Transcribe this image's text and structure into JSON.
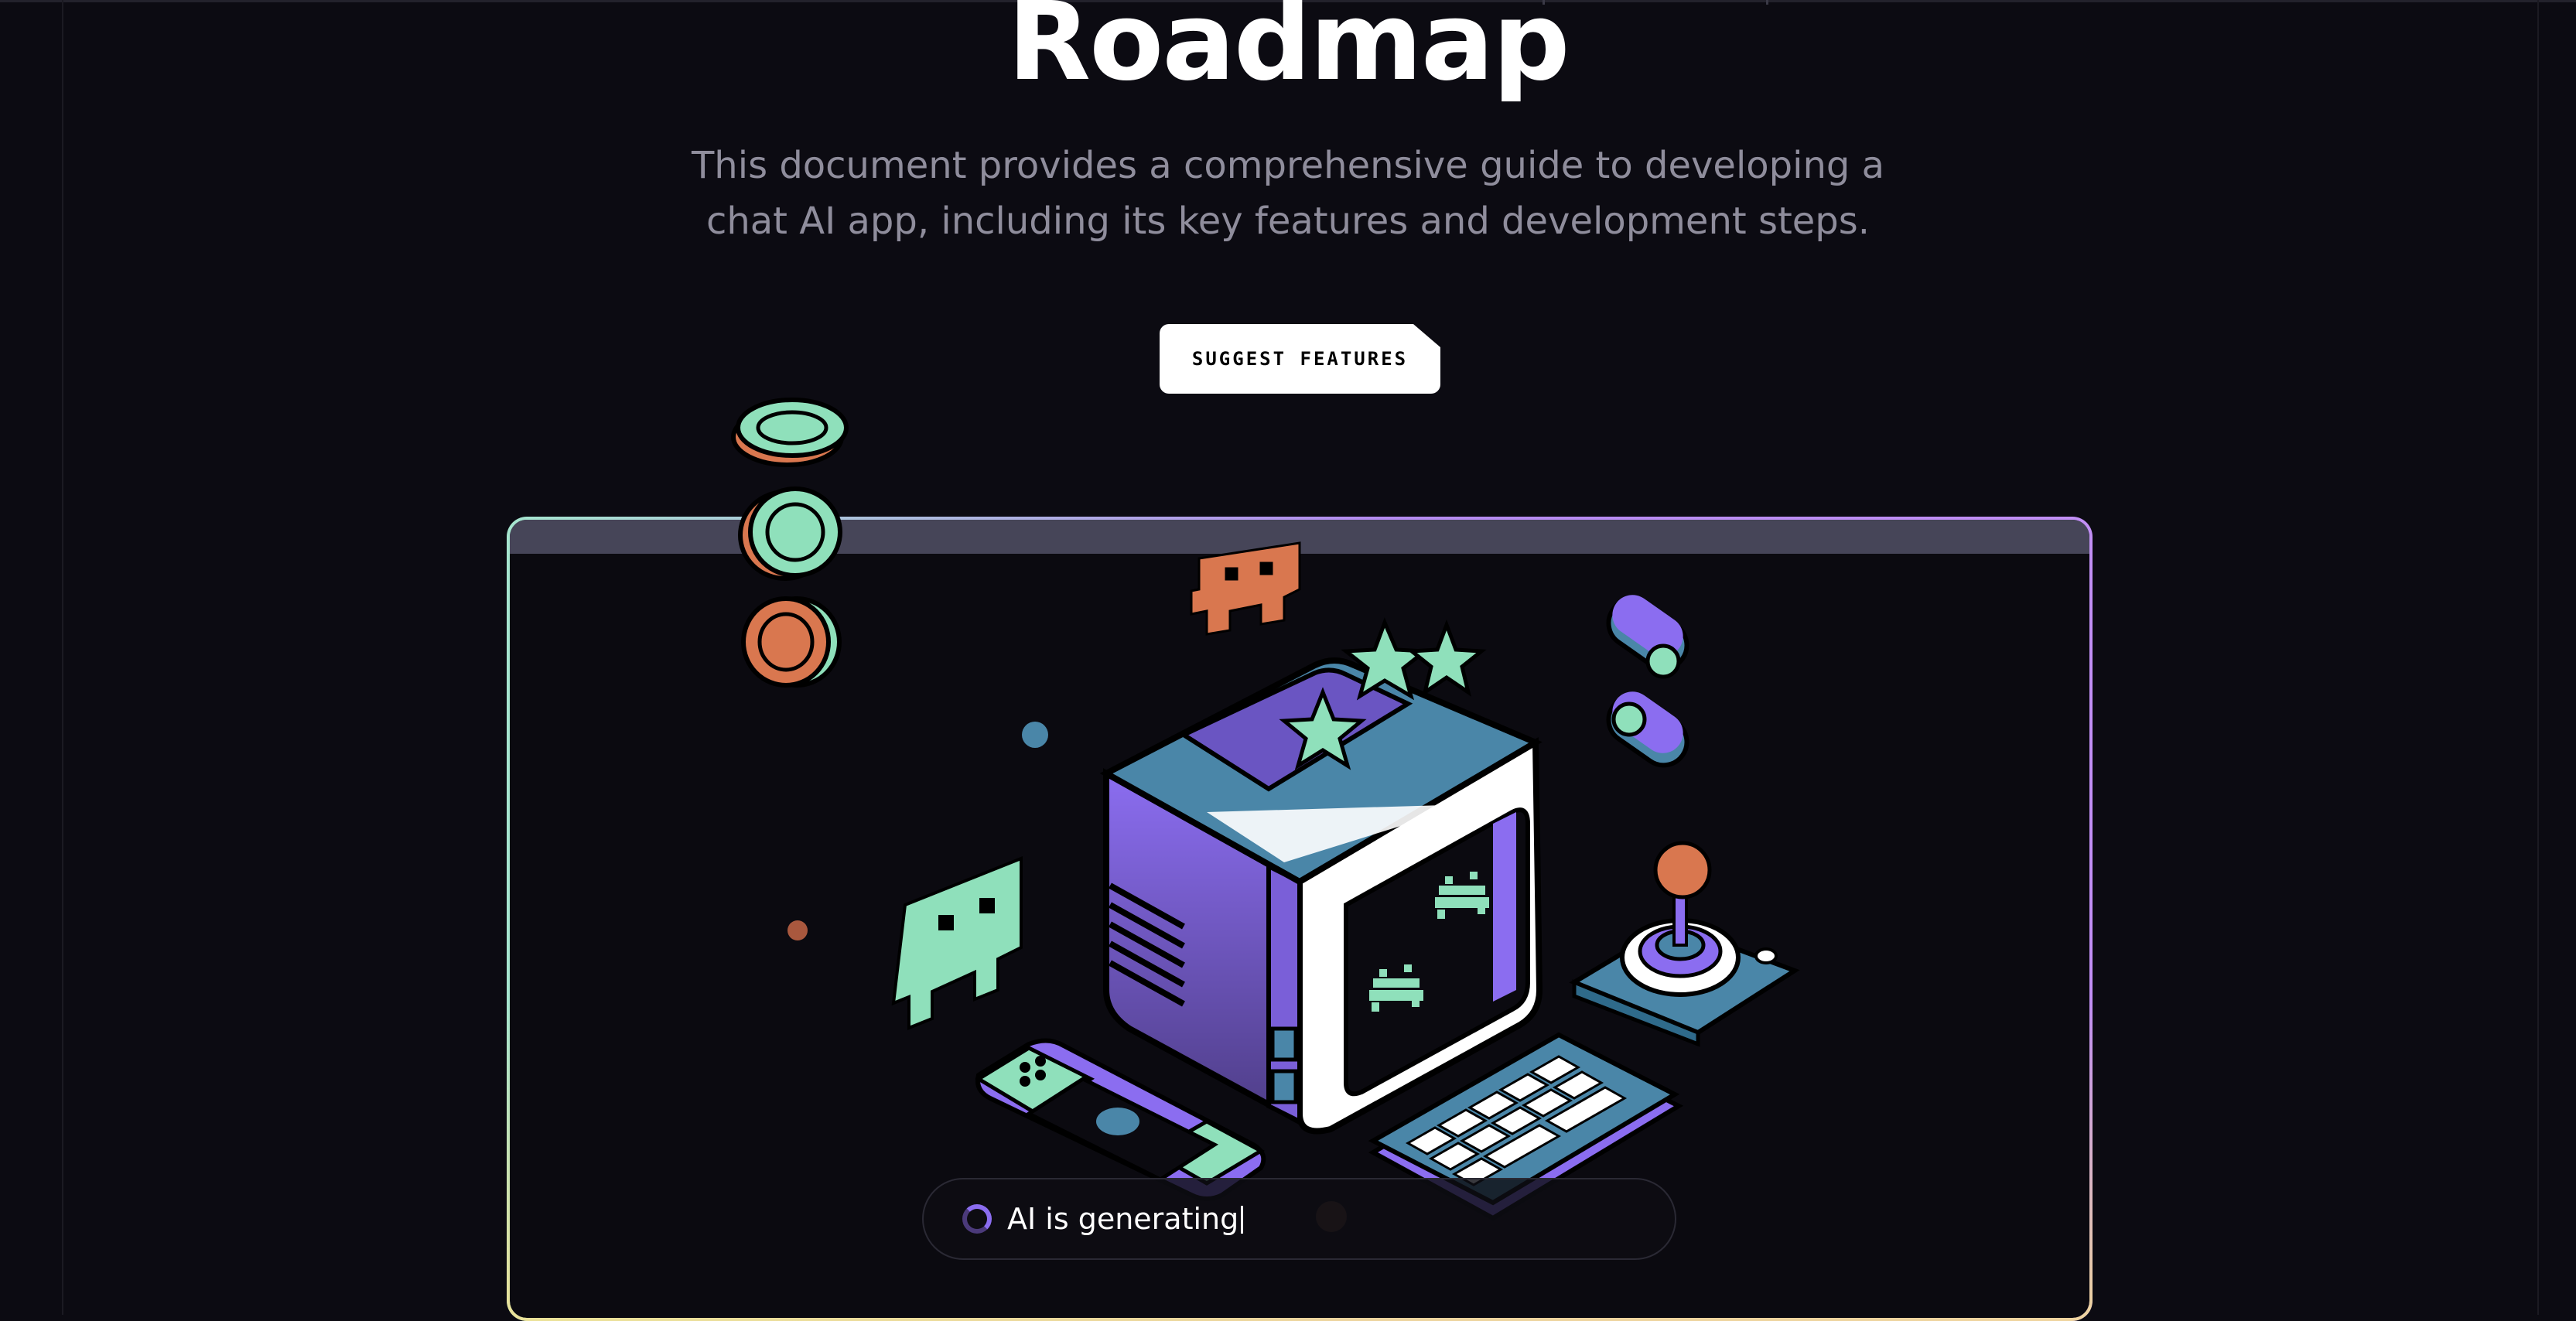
{
  "hero": {
    "title": "Roadmap",
    "subtitle_line1": "This document provides a comprehensive guide to developing a",
    "subtitle_line2": "chat AI app, including its key features and development steps.",
    "cta_label": "SUGGEST FEATURES"
  },
  "status": {
    "text": "AI is generating"
  },
  "colors": {
    "background": "#0c0b12",
    "mint": "#8fe0bb",
    "purple": "#8b6df0",
    "teal": "#4a86a8",
    "orange": "#d9774f",
    "frame_bar": "#464558"
  },
  "illustration": {
    "items": [
      "retro-computer-icon",
      "handheld-console-icon",
      "keyboard-icon",
      "joystick-icon",
      "coin-icon",
      "toggle-icon",
      "space-invader-icon",
      "star-icon"
    ]
  }
}
